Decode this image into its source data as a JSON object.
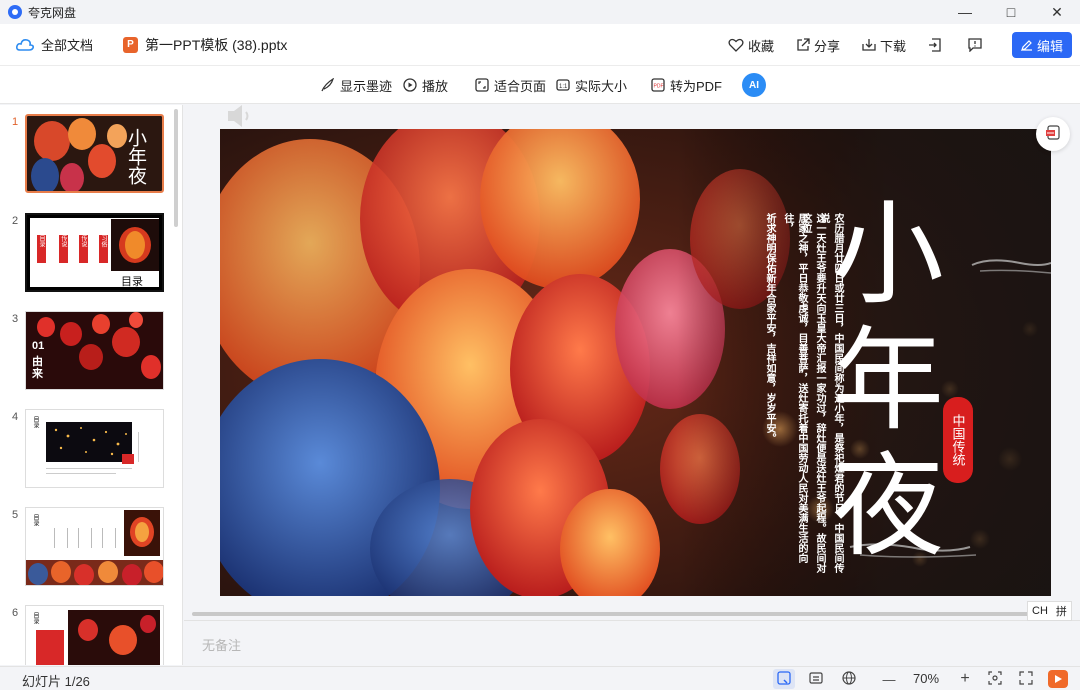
{
  "app": {
    "name": "夸克网盘"
  },
  "window": {
    "minimize": "—",
    "maximize": "□",
    "close": "✕"
  },
  "header": {
    "breadcrumb": "全部文档",
    "ppt_badge": "P",
    "filename": "第一PPT模板 (38).pptx",
    "favorite": "收藏",
    "share": "分享",
    "download": "下载",
    "edit": "编辑"
  },
  "toolbar": {
    "show_ink": "显示墨迹",
    "play": "播放",
    "fit_page": "适合页面",
    "actual_size": "实际大小",
    "to_pdf": "转为PDF",
    "ai": "AI"
  },
  "thumbnails": [
    {
      "num": "1",
      "title": "小年夜"
    },
    {
      "num": "2",
      "label": "目录",
      "items": [
        "目录",
        "传说",
        "传说",
        "习俗"
      ]
    },
    {
      "num": "3",
      "label_num": "01",
      "label": "由来"
    },
    {
      "num": "4",
      "label": "目录"
    },
    {
      "num": "5",
      "label": "目录"
    },
    {
      "num": "6",
      "label": "目录"
    }
  ],
  "slide": {
    "title_chars": [
      "小",
      "年",
      "夜"
    ],
    "seal": "中国传统",
    "col1": "农历腊月廿四日或廿三日，中国民间称为过小年，是祭祀灶君的节日。中国民间传说",
    "col2": "这一天灶王爷要升天向玉皇大帝汇报一家功过，辞灶便是送灶王爷起程。故民间对这位",
    "col3": "居家之神，平日恭敬虔诚，目善菩萨，送灶寄托着中国劳动人民对美满生活的向往，",
    "col4": "祈求神明保佑新年合家平安，吉祥如意，岁岁平安。"
  },
  "notes": {
    "placeholder": "无备注"
  },
  "ime": {
    "lang": "CH",
    "mode": "拼"
  },
  "status": {
    "slide_count": "幻灯片 1/26",
    "zoom": "70%",
    "zoom_out": "—",
    "zoom_in": "+"
  },
  "colors": {
    "accent": "#2b68f5",
    "ppt_orange": "#e8642b",
    "seal_red": "#d81e1e"
  }
}
